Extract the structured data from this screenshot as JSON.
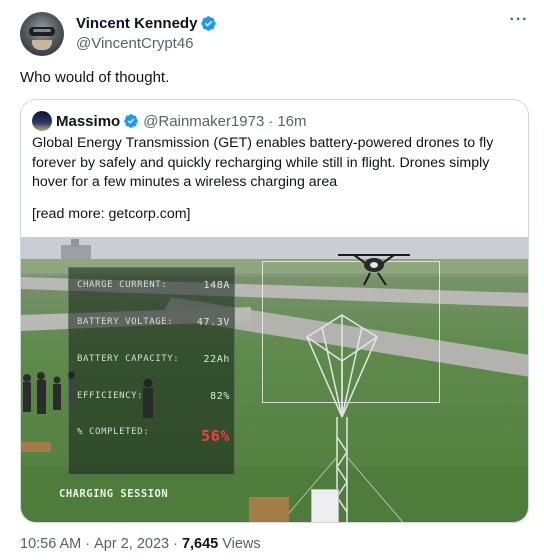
{
  "tweet": {
    "author": {
      "display_name": "Vincent Kennedy",
      "handle": "@VincentCrypt46"
    },
    "text": "Who would of thought.",
    "more_icon": "more-horizontal-icon"
  },
  "quoted_tweet": {
    "author": {
      "display_name": "Massimo",
      "handle": "@Rainmaker1973",
      "time": "16m"
    },
    "meta_separator": "·",
    "body": "Global Energy Transmission (GET) enables battery-powered drones to fly forever by safely and quickly recharging while still in flight. Drones simply hover for a few minutes a wireless charging area",
    "read_more": "[read more: getcorp.com]",
    "media": {
      "hud": [
        {
          "label": "CHARGE CURRENT:",
          "value": "148A"
        },
        {
          "label": "BATTERY VOLTAGE:",
          "value": "47.3V"
        },
        {
          "label": "BATTERY CAPACITY:",
          "value": "22Ah"
        },
        {
          "label": "EFFICIENCY:",
          "value": "82%"
        },
        {
          "label": "% COMPLETED:",
          "value": "56%"
        }
      ],
      "session_label": "CHARGING SESSION"
    }
  },
  "footer": {
    "time": "10:56 AM",
    "date": "Apr 2, 2023",
    "separator": "·",
    "views": "7,645",
    "views_label": "Views"
  },
  "colors": {
    "verified": "#1d9bf0",
    "secondary_text": "#536471",
    "hud_alert": "#ff3a3a"
  }
}
